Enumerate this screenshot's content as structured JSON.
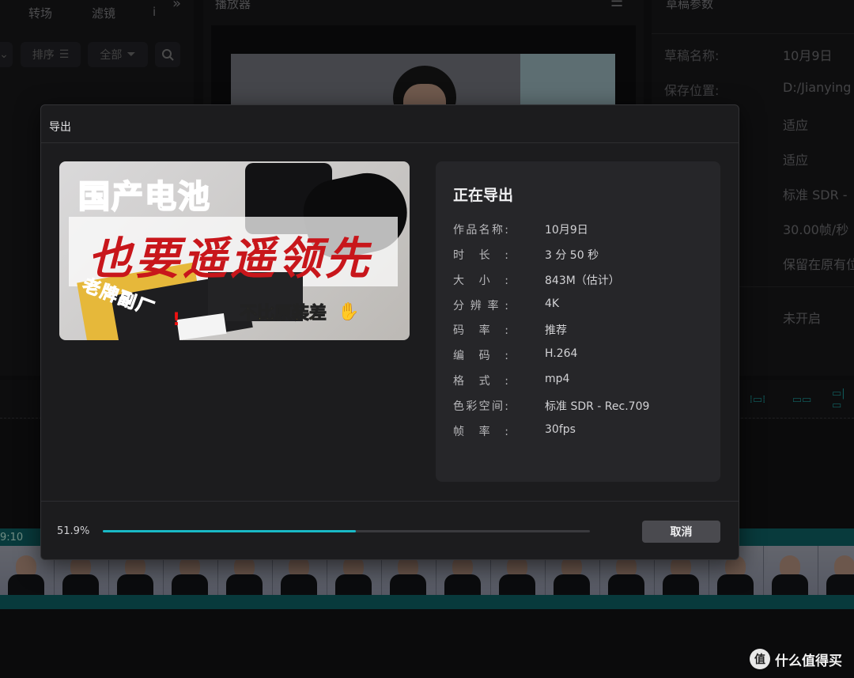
{
  "background": {
    "left_tabs": [
      "转场",
      "滤镜"
    ],
    "left_tab_cut": "i",
    "left_more": "»",
    "sort_chip": "排序",
    "filter_chip": "全部",
    "player_title": "播放器",
    "right_title": "草稿参数",
    "props": [
      {
        "label": "草稿名称:",
        "value": "10月9日"
      },
      {
        "label": "保存位置:",
        "value": "D:/Jianying"
      },
      {
        "label": "",
        "value": "适应"
      },
      {
        "label": "",
        "value": "适应"
      },
      {
        "label": "",
        "value": "标准 SDR -"
      },
      {
        "label": "",
        "value": "30.00帧/秒"
      },
      {
        "label": "",
        "value": "保留在原有位"
      },
      {
        "label": "",
        "value": "未开启"
      }
    ],
    "timecode": "9:10"
  },
  "dialog": {
    "title": "导出",
    "cover": {
      "title_gray": "国产电池",
      "title_red": "也要遥遥领先",
      "tag_small": "老牌副厂",
      "tag_yellow": "不比原装差",
      "hand": "✋",
      "mark": "!"
    },
    "status_title": "正在导出",
    "info": [
      {
        "k": "作品名称:",
        "v": "10月9日"
      },
      {
        "k": "时长:",
        "v": "3 分 50 秒"
      },
      {
        "k": "大小:",
        "v": "843M（估计）"
      },
      {
        "k": "分辨率:",
        "v": "4K"
      },
      {
        "k": "码率:",
        "v": "推荐"
      },
      {
        "k": "编码:",
        "v": "H.264"
      },
      {
        "k": "格式:",
        "v": "mp4"
      },
      {
        "k": "色彩空间:",
        "v": "标准 SDR - Rec.709"
      },
      {
        "k": "帧率:",
        "v": "30fps"
      }
    ],
    "progress_text": "51.9%",
    "progress": 0.519,
    "cancel_label": "取消"
  },
  "watermark": {
    "logo": "值",
    "text": "什么值得买"
  },
  "colors": {
    "accent": "#19b9c6",
    "track": "#0f6b6e"
  }
}
